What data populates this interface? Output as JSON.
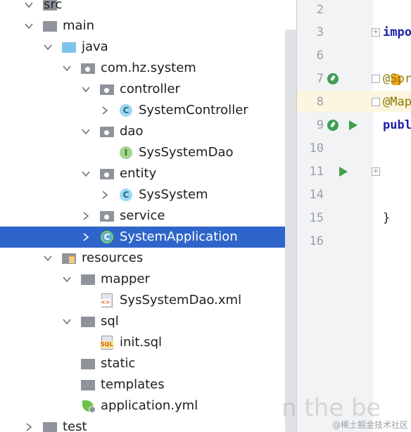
{
  "tree": {
    "items": [
      {
        "label": "src",
        "icon": "folder-grey-icon",
        "expanded": true
      },
      {
        "label": "main",
        "icon": "folder-grey-icon",
        "expanded": true
      },
      {
        "label": "java",
        "icon": "source-folder-blue-icon",
        "expanded": true
      },
      {
        "label": "com.hz.system",
        "icon": "package-icon",
        "expanded": true
      },
      {
        "label": "controller",
        "icon": "package-icon",
        "expanded": true
      },
      {
        "label": "SystemController",
        "icon": "class-icon",
        "expanded": false
      },
      {
        "label": "dao",
        "icon": "package-icon",
        "expanded": true
      },
      {
        "label": "SysSystemDao",
        "icon": "interface-icon"
      },
      {
        "label": "entity",
        "icon": "package-icon",
        "expanded": true
      },
      {
        "label": "SysSystem",
        "icon": "class-icon",
        "expanded": false
      },
      {
        "label": "service",
        "icon": "package-icon",
        "expanded": false
      },
      {
        "label": "SystemApplication",
        "icon": "spring-boot-app-icon",
        "expanded": false,
        "selected": true
      },
      {
        "label": "resources",
        "icon": "resources-folder-icon",
        "expanded": true
      },
      {
        "label": "mapper",
        "icon": "folder-grey-icon",
        "expanded": true
      },
      {
        "label": "SysSystemDao.xml",
        "icon": "xml-file-icon"
      },
      {
        "label": "sql",
        "icon": "folder-grey-icon",
        "expanded": true
      },
      {
        "label": "init.sql",
        "icon": "sql-file-icon"
      },
      {
        "label": "static",
        "icon": "folder-grey-icon"
      },
      {
        "label": "templates",
        "icon": "folder-grey-icon"
      },
      {
        "label": "application.yml",
        "icon": "spring-config-icon"
      },
      {
        "label": "test",
        "icon": "folder-grey-icon",
        "expanded": false
      }
    ]
  },
  "editor": {
    "line_numbers": [
      "2",
      "3",
      "6",
      "7",
      "8",
      "9",
      "10",
      "11",
      "14",
      "15",
      "16"
    ],
    "code": {
      "line3": "impo",
      "line7": "@Spr",
      "line8": "@Map",
      "line9": "publ",
      "line15": "}"
    },
    "fold_glyph": "+"
  },
  "watermark": "@稀土掘金技术社区",
  "overlay": "n the be",
  "colors": {
    "selection": "#2f65ca",
    "run_green": "#3fa14a",
    "keyword": "#1b1fa8",
    "annotation": "#8a7a00"
  }
}
